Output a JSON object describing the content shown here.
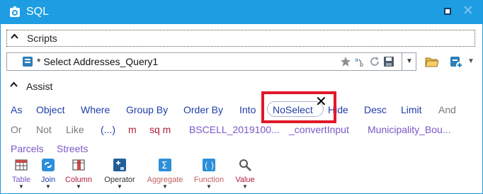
{
  "window": {
    "title": "SQL"
  },
  "scripts": {
    "label": "Scripts"
  },
  "query": {
    "value": "* Select Addresses_Query1"
  },
  "assist": {
    "label": "Assist"
  },
  "keywords_row1": [
    "As",
    "Object",
    "Where",
    "Group By",
    "Order By",
    "Into",
    "NoSelect",
    "Hide",
    "Desc",
    "Limit",
    "And"
  ],
  "keywords_row2": [
    "Or",
    "Not",
    "Like",
    "(...)",
    "m",
    "sq m",
    "BSCELL_2019100...",
    "_convertInput",
    "Municipality_Bou..."
  ],
  "keywords_row3": [
    "Parcels",
    "Streets"
  ],
  "toolbar": {
    "table": "Table",
    "join": "Join",
    "column": "Column",
    "operator": "Operator",
    "aggregate": "Aggregate",
    "function": "Function",
    "value": "Value"
  },
  "colors": {
    "titlebar": "#1e9de3",
    "keyword_blue": "#1f3ea8",
    "highlight_red": "#e0182a"
  }
}
